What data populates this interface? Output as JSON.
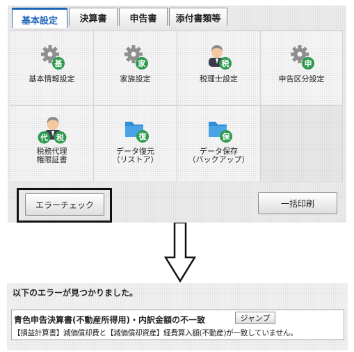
{
  "tabs": [
    {
      "label": "基本設定",
      "active": true
    },
    {
      "label": "決算書",
      "active": false
    },
    {
      "label": "申告書",
      "active": false
    },
    {
      "label": "添付書類等",
      "active": false
    }
  ],
  "tiles": [
    {
      "label": "基本情報設定",
      "icon": "gear-icon",
      "badge": "基",
      "badge_color": "#2e9a4f"
    },
    {
      "label": "家族設定",
      "icon": "gear-icon",
      "badge": "家",
      "badge_color": "#2e9a4f"
    },
    {
      "label": "税理士設定",
      "icon": "person-icon",
      "badge": "税",
      "badge_color": "#2e9a4f"
    },
    {
      "label": "申告区分設定",
      "icon": "gear-icon",
      "badge": "申",
      "badge_color": "#2e9a4f"
    },
    {
      "label_lines": [
        "税務代理",
        "権限証書"
      ],
      "icon": "person-icon",
      "badges": [
        "代",
        "税"
      ],
      "badge_color": "#2e9a4f"
    },
    {
      "label_lines": [
        "データ復元",
        "（リストア）"
      ],
      "icon": "folder-icon",
      "badge": "復",
      "badge_color": "#2e9a4f"
    },
    {
      "label_lines": [
        "データ保存",
        "（バックアップ）"
      ],
      "icon": "folder-icon",
      "badge": "保",
      "badge_color": "#2e9a4f"
    }
  ],
  "buttons": {
    "error_check": "エラーチェック",
    "batch_print": "一括印刷"
  },
  "result": {
    "title": "以下のエラーが見つかりました。",
    "error_heading": "青色申告決算書(不動産所得用)・内訳金額の不一致",
    "jump_label": "ジャンプ",
    "error_detail": "【損益計算書】減価償却費と【減価償却資産】経費算入額(不動産)が一致していません。"
  },
  "colors": {
    "accent": "#1b64b8",
    "badge_green": "#2e9a4f",
    "folder_blue": "#2f8fd8"
  }
}
